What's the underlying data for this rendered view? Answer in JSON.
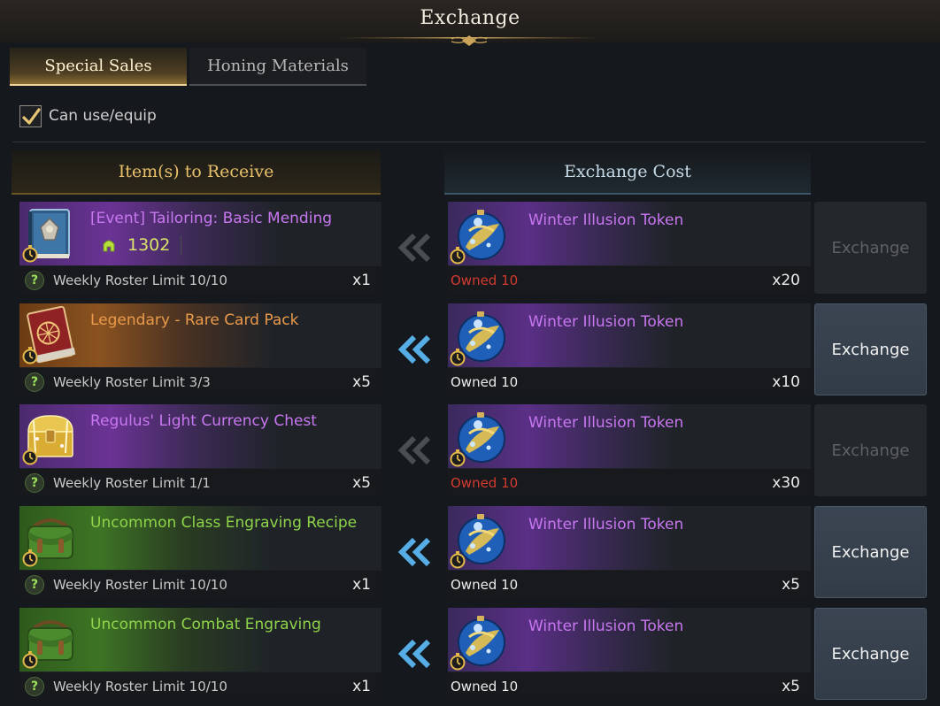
{
  "window": {
    "title": "Exchange"
  },
  "tabs": [
    {
      "label": "Special Sales",
      "active": true
    },
    {
      "label": "Honing Materials",
      "active": false
    }
  ],
  "filter": {
    "label": "Can use/equip",
    "checked": true
  },
  "columns": {
    "receive": "Item(s) to Receive",
    "cost": "Exchange Cost"
  },
  "colors": {
    "epic": "#c877f0",
    "legendary": "#e99a4b",
    "uncommon": "#8ed44a",
    "owned_insufficient": "#d43b30",
    "points": "#d9e36a"
  },
  "rows": [
    {
      "item_name": "[Event] Tailoring: Basic Mending",
      "rarity": "epic",
      "icon": "spellbook-icon",
      "points": "1302",
      "limit": "Weekly Roster Limit 10/10",
      "qty": "x1",
      "token_name": "Winter Illusion Token",
      "owned": "Owned 10",
      "owned_status": "insufficient",
      "cost": "x20",
      "button_label": "Exchange",
      "button_enabled": false
    },
    {
      "item_name": "Legendary - Rare Card Pack",
      "rarity": "legendary",
      "icon": "card-pack-icon",
      "limit": "Weekly Roster Limit 3/3",
      "qty": "x5",
      "token_name": "Winter Illusion Token",
      "owned": "Owned 10",
      "owned_status": "sufficient",
      "cost": "x10",
      "button_label": "Exchange",
      "button_enabled": true
    },
    {
      "item_name": "Regulus' Light Currency Chest",
      "rarity": "epic",
      "icon": "treasure-chest-icon",
      "limit": "Weekly Roster Limit 1/1",
      "qty": "x5",
      "token_name": "Winter Illusion Token",
      "owned": "Owned 10",
      "owned_status": "insufficient",
      "cost": "x30",
      "button_label": "Exchange",
      "button_enabled": false
    },
    {
      "item_name": "Uncommon Class Engraving Recipe",
      "rarity": "uncommon",
      "icon": "satchel-icon",
      "limit": "Weekly Roster Limit 10/10",
      "qty": "x1",
      "token_name": "Winter Illusion Token",
      "owned": "Owned 10",
      "owned_status": "sufficient",
      "cost": "x5",
      "button_label": "Exchange",
      "button_enabled": true
    },
    {
      "item_name": "Uncommon Combat Engraving",
      "rarity": "uncommon",
      "icon": "satchel-icon",
      "limit": "Weekly Roster Limit 10/10",
      "qty": "x1",
      "token_name": "Winter Illusion Token",
      "owned": "Owned 10",
      "owned_status": "sufficient",
      "cost": "x5",
      "button_label": "Exchange",
      "button_enabled": true
    }
  ]
}
